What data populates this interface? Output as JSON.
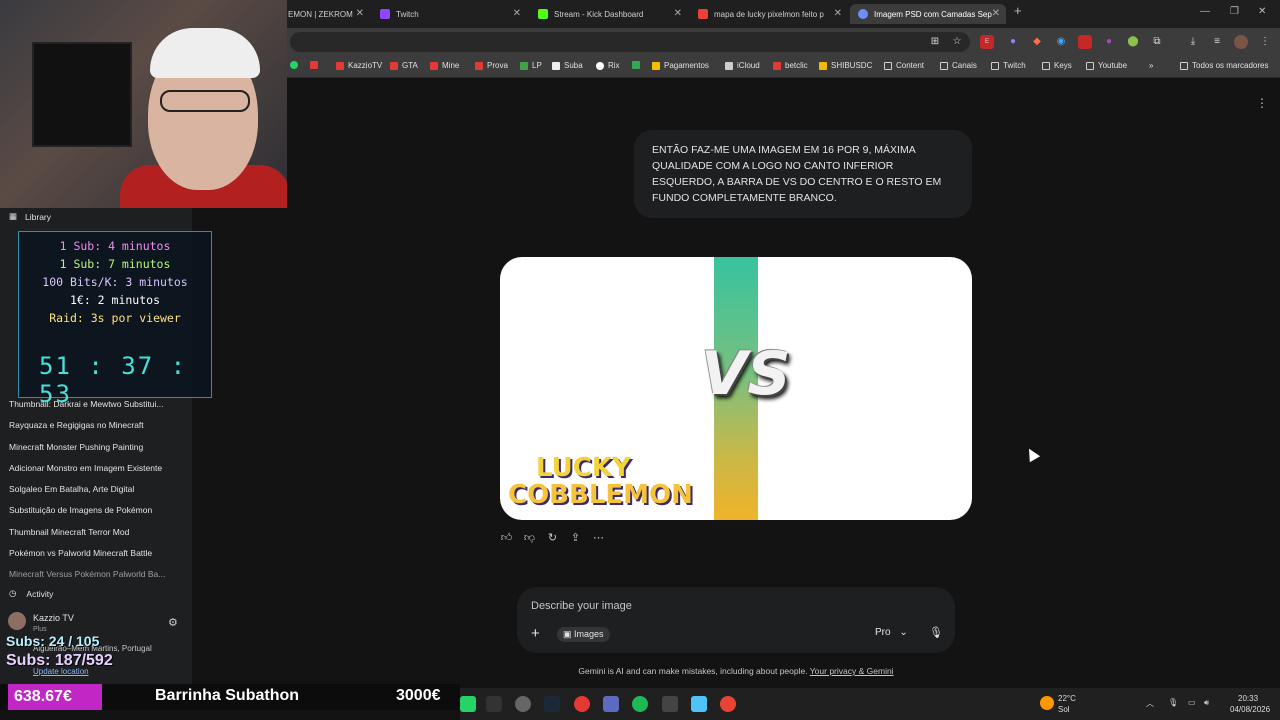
{
  "tabs": [
    {
      "label": "EMON | ZEKROM",
      "active": false
    },
    {
      "label": "Twitch",
      "active": false
    },
    {
      "label": "Stream - Kick Dashboard",
      "active": false
    },
    {
      "label": "mapa de lucky pixelmon feito p",
      "active": false
    },
    {
      "label": "Imagem PSD com Camadas Sep",
      "active": true
    }
  ],
  "bookmarks": [
    "KazzioTV",
    "GTA",
    "Mine",
    "Prova",
    "LP",
    "Suba",
    "Rix",
    "Pagamentos",
    "iCloud",
    "betclic",
    "SHIBUSDC",
    "Content",
    "Canais",
    "Twitch",
    "Keys",
    "Youtube"
  ],
  "bookmarks_all": "Todos os marcadores",
  "sidebar": {
    "library": "Library",
    "items": [
      "Thumbnail: Darkrai e Mewtwo Substitui...",
      "Rayquaza e Regigigas no Minecraft",
      "Minecraft Monster Pushing Painting",
      "Adicionar Monstro em Imagem Existente",
      "Solgaleo Em Batalha, Arte Digital",
      "Substituição de Imagens de Pokémon",
      "Thumbnail Minecraft Terror Mod",
      "Pokémon vs Palworld Minecraft Battle",
      "Minecraft Versus Pokémon Palworld Ba..."
    ],
    "activity": "Activity",
    "account_name": "Kazzio TV",
    "account_plan": "Plus",
    "location": "Algueirão–Mem Martins, Portugal",
    "update_location": "Update location"
  },
  "subathon": {
    "lines": [
      "1 Sub: 4 minutos",
      "1 Sub: 7 minutos",
      "100 Bits/K: 3 minutos",
      "1€: 2 minutos",
      "Raid: 3s por viewer"
    ],
    "timer": "51 : 37 : 53"
  },
  "chat": {
    "user_message": "ENTÃO FAZ-ME UMA IMAGEM EM 16 POR 9, MÁXIMA QUALIDADE COM A LOGO NO CANTO INFERIOR ESQUERDO, A BARRA DE VS DO CENTRO E O RESTO EM FUNDO COMPLETAMENTE BRANCO.",
    "image_vs_text": "VS",
    "logo_line1": "LUCKY",
    "logo_line2": "COBBLEMON"
  },
  "prompt": {
    "placeholder": "Describe your image",
    "chip": "Images",
    "model": "Pro"
  },
  "disclaimer": "Gemini is AI and can make mistakes, including about people.",
  "disclaimer_link": "Your privacy & Gemini",
  "overlay": {
    "subs_a": "Subs: 24 / 105",
    "subs_b": "Subs: 187/592",
    "money": "638.67€",
    "title": "Barrinha Subathon",
    "goal": "3000€"
  },
  "taskbar": {
    "temp": "22°C",
    "weather": "Sol",
    "time": "20:33",
    "date": "04/08/2026"
  }
}
